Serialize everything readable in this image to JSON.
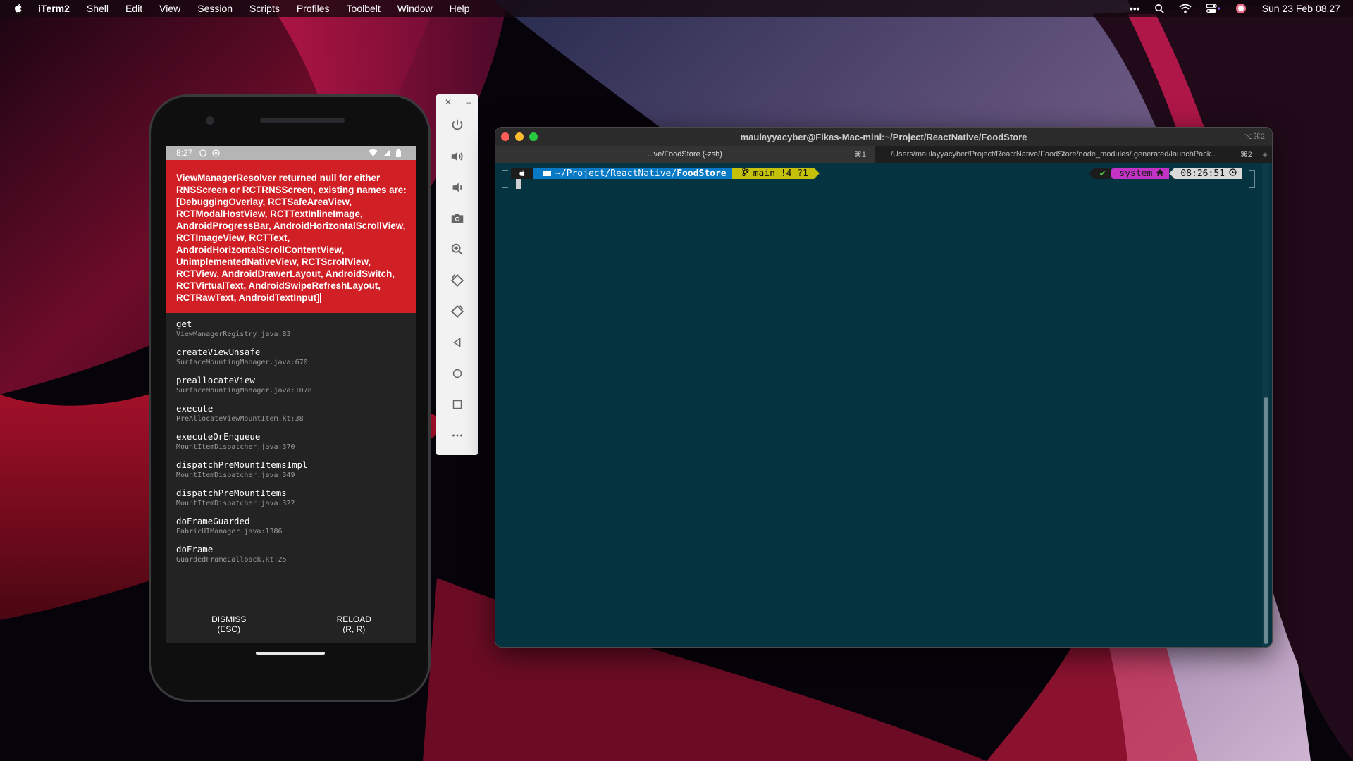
{
  "menubar": {
    "app_name": "iTerm2",
    "items": [
      "Shell",
      "Edit",
      "View",
      "Session",
      "Scripts",
      "Profiles",
      "Toolbelt",
      "Window",
      "Help"
    ],
    "more": "•••",
    "datetime": "Sun 23 Feb  08.27"
  },
  "phone": {
    "status_time": "8:27",
    "error_message": "ViewManagerResolver returned null for either RNSScreen or RCTRNSScreen, existing names are: [DebuggingOverlay, RCTSafeAreaView, RCTModalHostView, RCTTextInlineImage, AndroidProgressBar, AndroidHorizontalScrollView, RCTImageView, RCTText, AndroidHorizontalScrollContentView, UnimplementedNativeView, RCTScrollView, RCTView, AndroidDrawerLayout, AndroidSwitch, RCTVirtualText, AndroidSwipeRefreshLayout, RCTRawText, AndroidTextInput]",
    "stack": [
      {
        "fn": "get",
        "loc": "ViewManagerRegistry.java:83"
      },
      {
        "fn": "createViewUnsafe",
        "loc": "SurfaceMountingManager.java:670"
      },
      {
        "fn": "preallocateView",
        "loc": "SurfaceMountingManager.java:1078"
      },
      {
        "fn": "execute",
        "loc": "PreAllocateViewMountItem.kt:38"
      },
      {
        "fn": "executeOrEnqueue",
        "loc": "MountItemDispatcher.java:370"
      },
      {
        "fn": "dispatchPreMountItemsImpl",
        "loc": "MountItemDispatcher.java:349"
      },
      {
        "fn": "dispatchPreMountItems",
        "loc": "MountItemDispatcher.java:322"
      },
      {
        "fn": "doFrameGuarded",
        "loc": "FabricUIManager.java:1386"
      },
      {
        "fn": "doFrame",
        "loc": "GuardedFrameCallback.kt:25"
      }
    ],
    "dismiss_label": "DISMISS",
    "dismiss_hint": "(ESC)",
    "reload_label": "RELOAD",
    "reload_hint": "(R, R)"
  },
  "emulator_toolbar": {
    "close": "✕",
    "minimize": "–",
    "tools": [
      "power-icon",
      "volume-up-icon",
      "volume-down-icon",
      "camera-icon",
      "zoom-icon",
      "rotate-left-icon",
      "rotate-right-icon",
      "back-icon",
      "home-icon",
      "overview-icon",
      "more-icon"
    ]
  },
  "iterm": {
    "title": "maulayyacyber@Fikas-Mac-mini:~/Project/ReactNative/FoodStore",
    "title_shortcut": "⌥⌘2",
    "tabs": [
      {
        "label": "..ive/FoodStore (-zsh)",
        "shortcut": "⌘1"
      },
      {
        "label": "/Users/maulayyacyber/Project/ReactNative/FoodStore/node_modules/.generated/launchPack...",
        "shortcut": "⌘2"
      }
    ],
    "new_tab": "+",
    "prompt": {
      "path_prefix": "~/Project/ReactNative/",
      "path_current": "FoodStore",
      "git_branch": "main !4 ?1",
      "status": "✔",
      "context": "system",
      "time": "08:26:51"
    }
  },
  "colors": {
    "error_red": "#d11f26",
    "terminal_bg": "#05333f",
    "prompt_path": "#0879c5",
    "prompt_git": "#c5c00a",
    "prompt_context": "#c132c5"
  }
}
